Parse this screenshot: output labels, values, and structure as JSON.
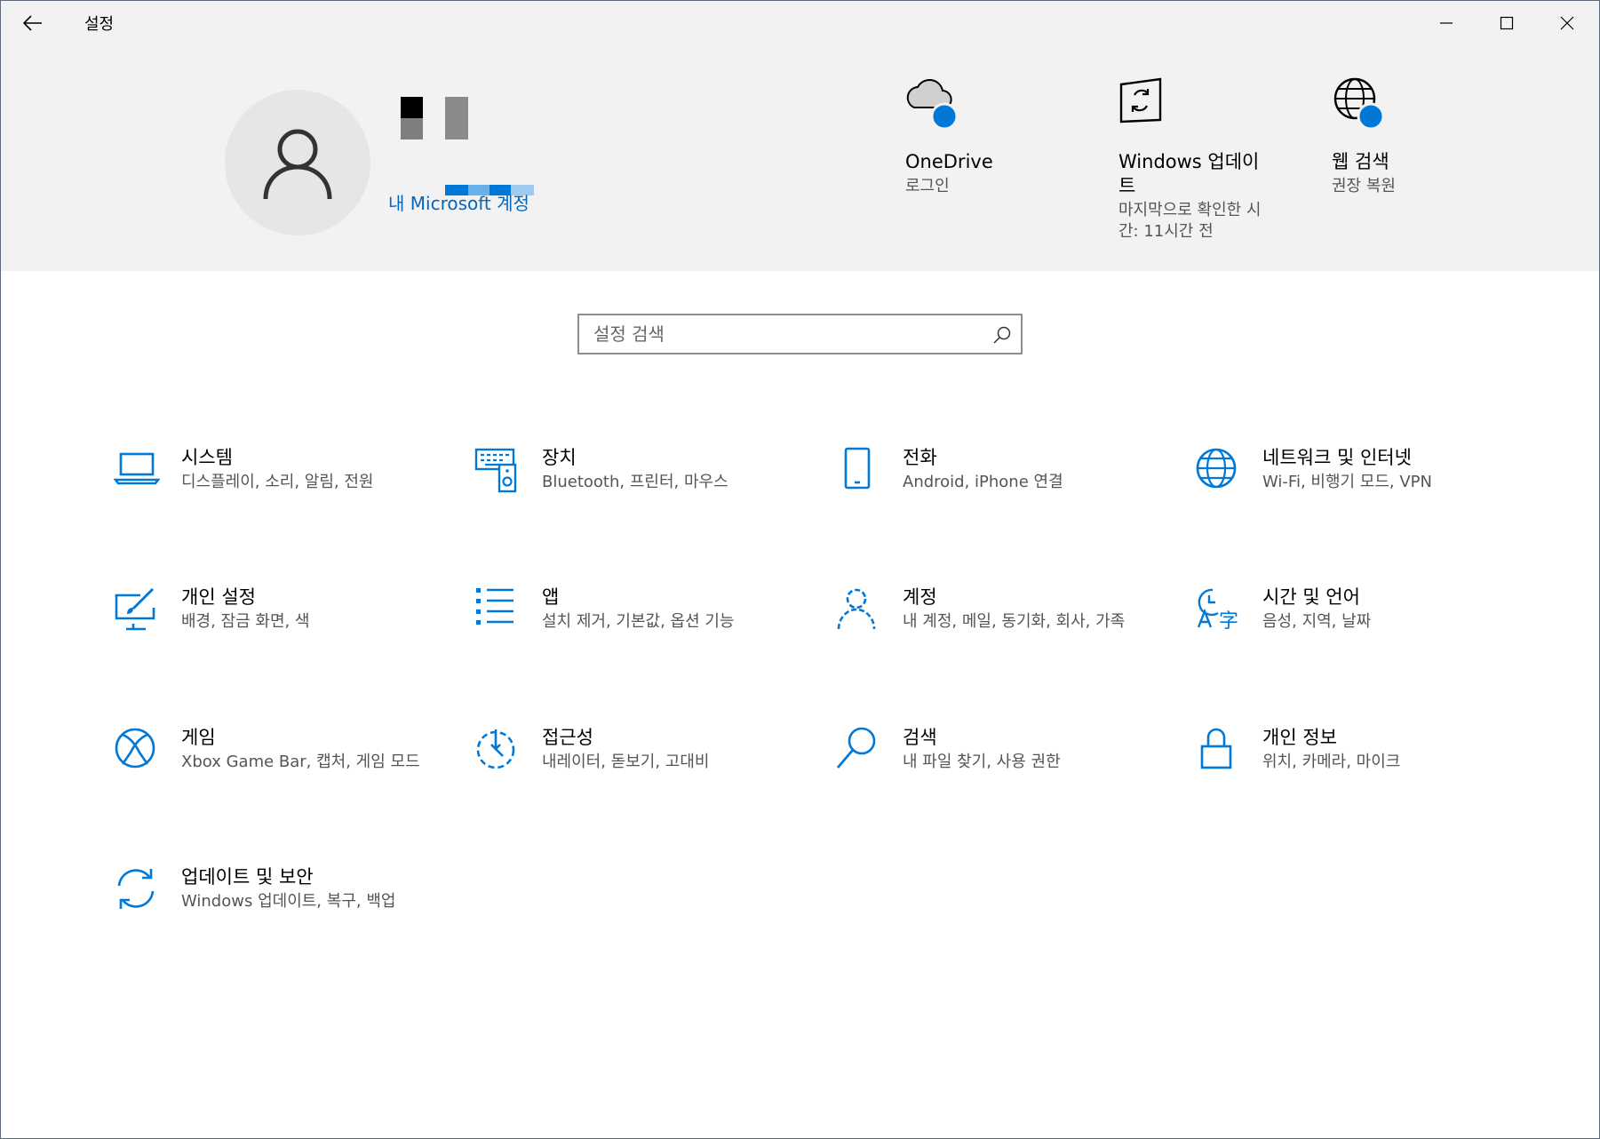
{
  "window": {
    "title": "설정"
  },
  "account": {
    "link": "내 Microsoft 계정"
  },
  "quick_links": [
    {
      "title": "OneDrive",
      "subtitle": "로그인",
      "icon": "onedrive-cloud-icon"
    },
    {
      "title": "Windows 업데이트",
      "subtitle": "마지막으로 확인한 시간: 11시간 전",
      "icon": "windows-update-icon"
    },
    {
      "title": "웹 검색",
      "subtitle": "권장 복원",
      "icon": "web-search-globe-icon"
    }
  ],
  "search": {
    "placeholder": "설정 검색"
  },
  "categories": [
    {
      "title": "시스템",
      "desc": "디스플레이, 소리, 알림, 전원",
      "icon": "laptop-icon"
    },
    {
      "title": "장치",
      "desc": "Bluetooth, 프린터, 마우스",
      "icon": "keyboard-speaker-icon"
    },
    {
      "title": "전화",
      "desc": "Android, iPhone 연결",
      "icon": "phone-icon"
    },
    {
      "title": "네트워크 및 인터넷",
      "desc": "Wi-Fi, 비행기 모드, VPN",
      "icon": "globe-icon"
    },
    {
      "title": "개인 설정",
      "desc": "배경, 잠금 화면, 색",
      "icon": "paint-brush-monitor-icon"
    },
    {
      "title": "앱",
      "desc": "설치 제거, 기본값, 옵션 기능",
      "icon": "apps-list-icon"
    },
    {
      "title": "계정",
      "desc": "내 계정, 메일, 동기화, 회사, 가족",
      "icon": "person-icon"
    },
    {
      "title": "시간 및 언어",
      "desc": "음성, 지역, 날짜",
      "icon": "time-language-icon"
    },
    {
      "title": "게임",
      "desc": "Xbox Game Bar, 캡처, 게임 모드",
      "icon": "xbox-icon"
    },
    {
      "title": "접근성",
      "desc": "내레이터, 돋보기, 고대비",
      "icon": "accessibility-timer-icon"
    },
    {
      "title": "검색",
      "desc": "내 파일 찾기, 사용 권한",
      "icon": "magnifier-icon"
    },
    {
      "title": "개인 정보",
      "desc": "위치, 카메라, 마이크",
      "icon": "lock-icon"
    },
    {
      "title": "업데이트 및 보안",
      "desc": "Windows 업데이트, 복구, 백업",
      "icon": "sync-arrows-icon"
    }
  ],
  "colors": {
    "accent": "#0078d7",
    "link": "#0067c0",
    "header_bg": "#f2f2f2",
    "secondary_text": "#555555"
  }
}
